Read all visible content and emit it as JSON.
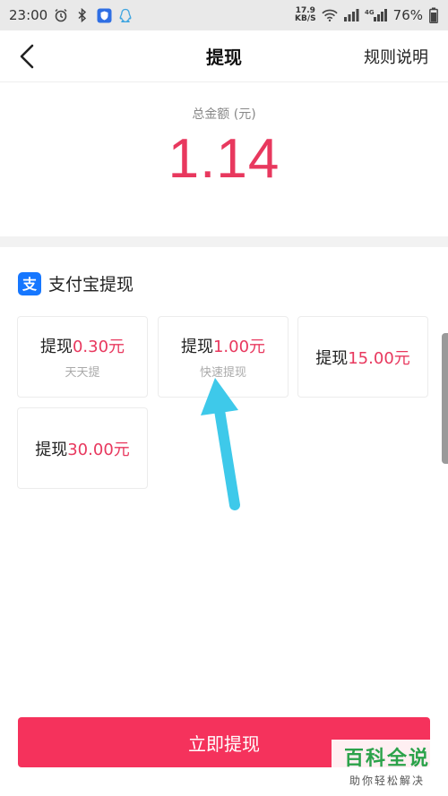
{
  "status_bar": {
    "time": "23:00",
    "speed_value": "17.9",
    "speed_unit": "KB/S",
    "network": "4G",
    "battery": "76%"
  },
  "nav": {
    "title": "提现",
    "rules_label": "规则说明"
  },
  "total": {
    "label": "总金额 (元)",
    "amount": "1.14"
  },
  "alipay": {
    "title": "支付宝提现",
    "icon_glyph": "支",
    "brand_color": "#1677ff"
  },
  "options": [
    {
      "prefix": "提现",
      "amount": "0.30元",
      "sub": "天天提"
    },
    {
      "prefix": "提现",
      "amount": "1.00元",
      "sub": "快速提现"
    },
    {
      "prefix": "提现",
      "amount": "15.00元",
      "sub": ""
    },
    {
      "prefix": "提现",
      "amount": "30.00元",
      "sub": ""
    }
  ],
  "withdraw_button": {
    "label": "立即提现",
    "color": "#f5325c"
  },
  "watermark": {
    "main": "百科全说",
    "sub": "助你轻松解决"
  },
  "colors": {
    "accent": "#e8385e",
    "arrow": "#3ec9ea"
  }
}
